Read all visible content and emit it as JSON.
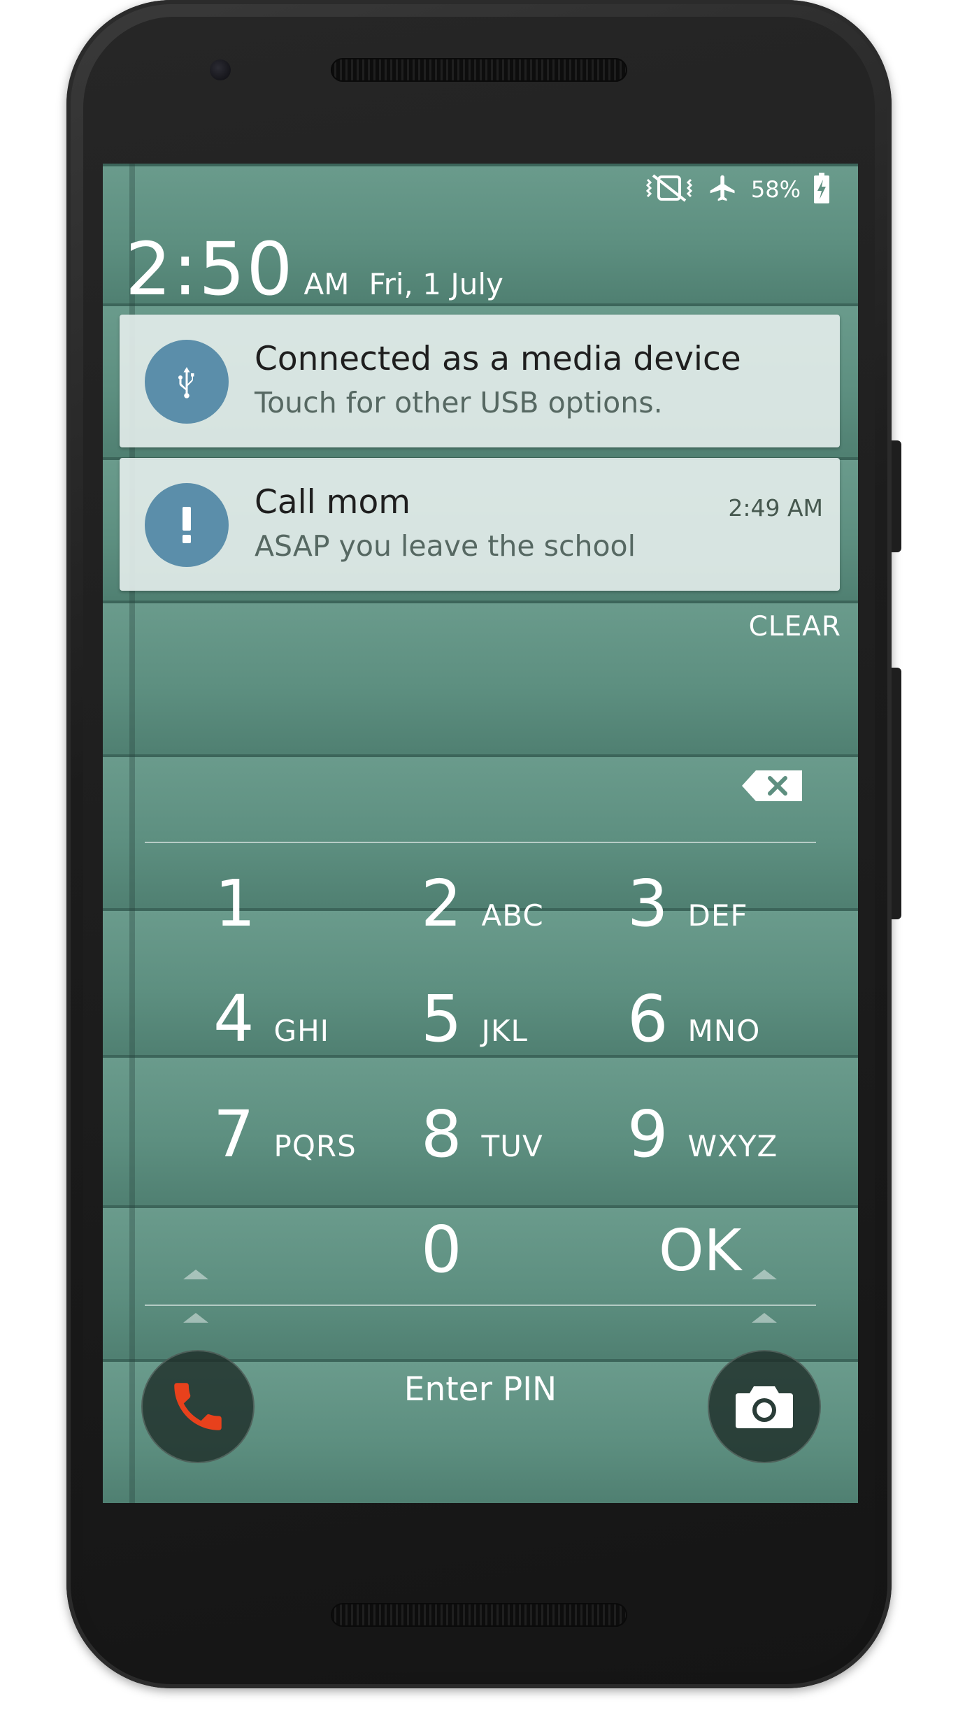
{
  "status_bar": {
    "battery_percent": "58%",
    "icons": [
      "vibrate-icon",
      "airplane-icon",
      "battery-charging-icon"
    ]
  },
  "lockscreen": {
    "time": "2:50",
    "ampm": "AM",
    "date": "Fri, 1 July"
  },
  "notifications": [
    {
      "icon": "usb-icon",
      "title": "Connected as a media device",
      "text": "Touch for other USB options.",
      "time": ""
    },
    {
      "icon": "alert-icon",
      "title": "Call mom",
      "text": "ASAP you leave the school",
      "time": "2:49 AM"
    }
  ],
  "clear_label": "CLEAR",
  "keypad": {
    "keys": [
      {
        "digit": "1",
        "letters": ""
      },
      {
        "digit": "2",
        "letters": "ABC"
      },
      {
        "digit": "3",
        "letters": "DEF"
      },
      {
        "digit": "4",
        "letters": "GHI"
      },
      {
        "digit": "5",
        "letters": "JKL"
      },
      {
        "digit": "6",
        "letters": "MNO"
      },
      {
        "digit": "7",
        "letters": "PQRS"
      },
      {
        "digit": "8",
        "letters": "TUV"
      },
      {
        "digit": "9",
        "letters": "WXYZ"
      },
      {
        "digit": "0",
        "letters": ""
      }
    ],
    "ok_label": "OK"
  },
  "prompt": "Enter PIN",
  "colors": {
    "wallpaper": "#5e8f80",
    "notification_icon_bg": "#5b8eaa",
    "phone_shortcut": "#e8411c"
  }
}
